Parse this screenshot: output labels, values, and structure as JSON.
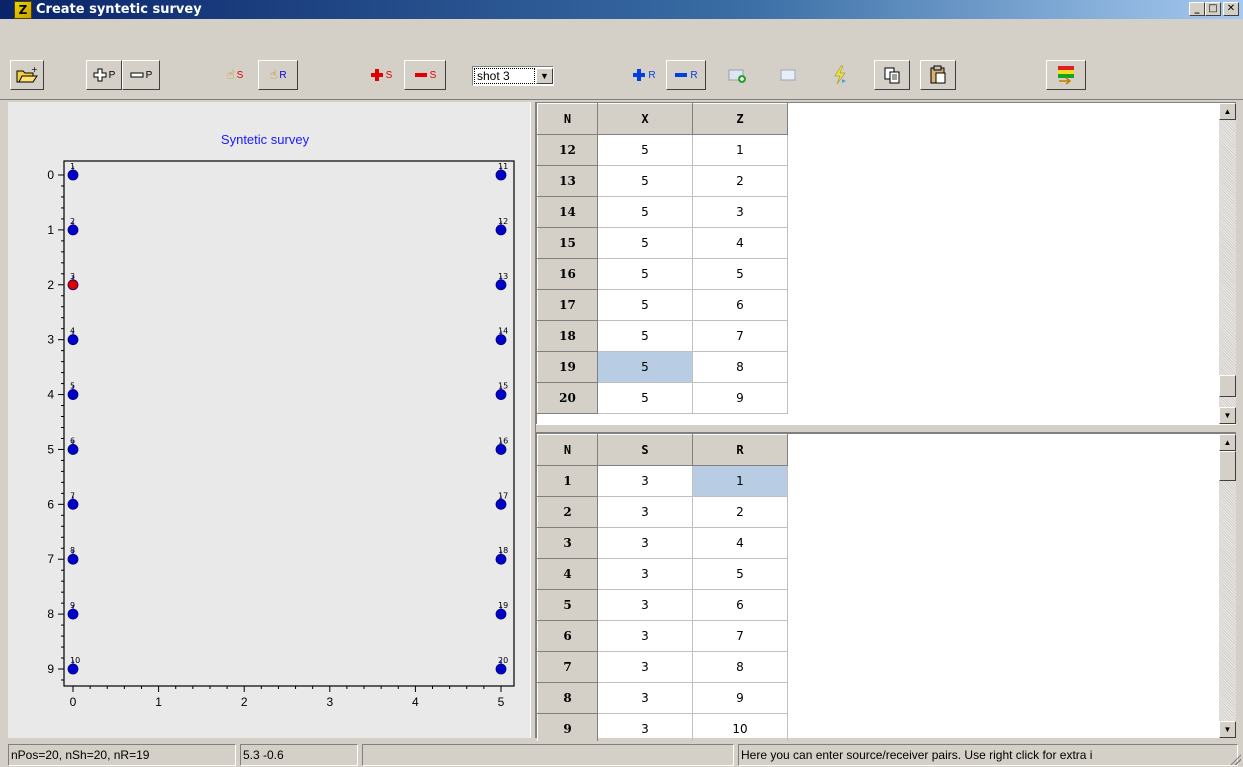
{
  "window": {
    "title": "Create syntetic survey",
    "logo_letter": "Z",
    "minimize_label": "_",
    "maximize_label": "□",
    "close_label": "✕"
  },
  "toolbar": {
    "open_icon": "open-folder-icon",
    "add_p": "P",
    "remove_p": "P",
    "pick_s": "S",
    "pick_r": "R",
    "add_s": "S",
    "remove_s": "S",
    "shot_select": "shot 3",
    "add_r": "R",
    "remove_r": "R"
  },
  "plot": {
    "title": "Syntetic survey",
    "x_ticks": [
      "0",
      "1",
      "2",
      "3",
      "4",
      "5"
    ],
    "y_ticks": [
      "0",
      "1",
      "2",
      "3",
      "4",
      "5",
      "6",
      "7",
      "8",
      "9"
    ],
    "point_labels_left": [
      "1",
      "2",
      "3",
      "4",
      "5",
      "6",
      "7",
      "8",
      "9",
      "10"
    ],
    "point_labels_right": [
      "11",
      "12",
      "13",
      "14",
      "15",
      "16",
      "17",
      "18",
      "19",
      "20"
    ],
    "colors": {
      "normal": "#0000cc",
      "selected": "#e00000",
      "title": "#1a1aff"
    }
  },
  "chart_data": {
    "type": "scatter",
    "title": "Syntetic survey",
    "xlabel": "",
    "ylabel": "",
    "xlim": [
      0,
      5
    ],
    "ylim": [
      0,
      9
    ],
    "y_inverted": true,
    "grid": false,
    "points": [
      {
        "n": 1,
        "x": 0,
        "z": 0
      },
      {
        "n": 2,
        "x": 0,
        "z": 1
      },
      {
        "n": 3,
        "x": 0,
        "z": 2,
        "selected": true
      },
      {
        "n": 4,
        "x": 0,
        "z": 3
      },
      {
        "n": 5,
        "x": 0,
        "z": 4
      },
      {
        "n": 6,
        "x": 0,
        "z": 5
      },
      {
        "n": 7,
        "x": 0,
        "z": 6
      },
      {
        "n": 8,
        "x": 0,
        "z": 7
      },
      {
        "n": 9,
        "x": 0,
        "z": 8
      },
      {
        "n": 10,
        "x": 0,
        "z": 9
      },
      {
        "n": 11,
        "x": 5,
        "z": 0
      },
      {
        "n": 12,
        "x": 5,
        "z": 1
      },
      {
        "n": 13,
        "x": 5,
        "z": 2
      },
      {
        "n": 14,
        "x": 5,
        "z": 3
      },
      {
        "n": 15,
        "x": 5,
        "z": 4
      },
      {
        "n": 16,
        "x": 5,
        "z": 5
      },
      {
        "n": 17,
        "x": 5,
        "z": 6
      },
      {
        "n": 18,
        "x": 5,
        "z": 7
      },
      {
        "n": 19,
        "x": 5,
        "z": 8
      },
      {
        "n": 20,
        "x": 5,
        "z": 9
      }
    ]
  },
  "positions_table": {
    "headers": [
      "N",
      "X",
      "Z"
    ],
    "rows": [
      [
        "12",
        "5",
        "1"
      ],
      [
        "13",
        "5",
        "2"
      ],
      [
        "14",
        "5",
        "3"
      ],
      [
        "15",
        "5",
        "4"
      ],
      [
        "16",
        "5",
        "5"
      ],
      [
        "17",
        "5",
        "6"
      ],
      [
        "18",
        "5",
        "7"
      ],
      [
        "19",
        "5",
        "8"
      ],
      [
        "20",
        "5",
        "9"
      ]
    ]
  },
  "pairs_table": {
    "headers": [
      "N",
      "S",
      "R"
    ],
    "rows": [
      [
        "1",
        "3",
        "1"
      ],
      [
        "2",
        "3",
        "2"
      ],
      [
        "3",
        "3",
        "4"
      ],
      [
        "4",
        "3",
        "5"
      ],
      [
        "5",
        "3",
        "6"
      ],
      [
        "6",
        "3",
        "7"
      ],
      [
        "7",
        "3",
        "8"
      ],
      [
        "8",
        "3",
        "9"
      ],
      [
        "9",
        "3",
        "10"
      ]
    ]
  },
  "status": {
    "counts": "nPos=20, nSh=20, nR=19",
    "coords": "5.3 -0.6",
    "empty": "",
    "hint": "Here you can enter source/receiver pairs. Use right click for extra i"
  }
}
